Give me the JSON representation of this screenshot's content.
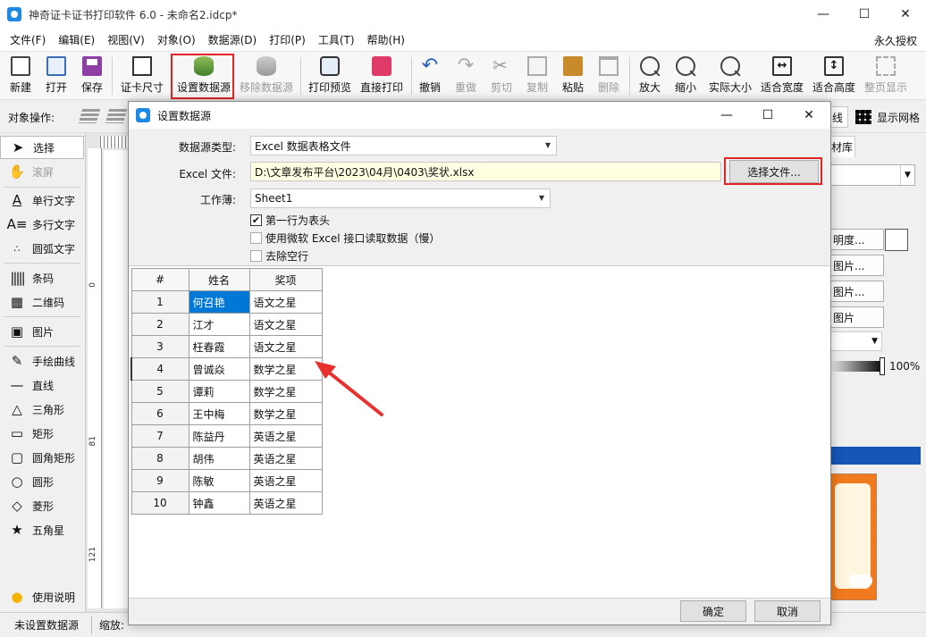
{
  "window": {
    "title": "神奇证卡证书打印软件 6.0 - 未命名2.idcp*",
    "minimize": "—",
    "maximize": "☐",
    "close": "✕"
  },
  "menu": {
    "items": [
      "文件(F)",
      "编辑(E)",
      "视图(V)",
      "对象(O)",
      "数据源(D)",
      "打印(P)",
      "工具(T)",
      "帮助(H)"
    ],
    "right": "永久授权"
  },
  "toolbar": {
    "buttons": [
      {
        "label": "新建",
        "icon": "new-file-icon"
      },
      {
        "label": "打开",
        "icon": "open-icon"
      },
      {
        "label": "保存",
        "icon": "save-icon"
      },
      {
        "label": "证卡尺寸",
        "icon": "card-size-icon"
      },
      {
        "label": "设置数据源",
        "icon": "database-icon"
      },
      {
        "label": "移除数据源",
        "icon": "remove-database-icon"
      },
      {
        "label": "打印预览",
        "icon": "print-preview-icon"
      },
      {
        "label": "直接打印",
        "icon": "printer-icon"
      },
      {
        "label": "撤销",
        "icon": "undo-icon"
      },
      {
        "label": "重做",
        "icon": "redo-icon"
      },
      {
        "label": "剪切",
        "icon": "cut-icon"
      },
      {
        "label": "复制",
        "icon": "copy-icon"
      },
      {
        "label": "粘贴",
        "icon": "paste-icon"
      },
      {
        "label": "删除",
        "icon": "delete-icon"
      },
      {
        "label": "放大",
        "icon": "zoom-in-icon"
      },
      {
        "label": "缩小",
        "icon": "zoom-out-icon"
      },
      {
        "label": "实际大小",
        "icon": "actual-size-icon"
      },
      {
        "label": "适合宽度",
        "icon": "fit-width-icon"
      },
      {
        "label": "适合高度",
        "icon": "fit-height-icon"
      },
      {
        "label": "整页显示",
        "icon": "full-page-icon"
      }
    ]
  },
  "objbar": {
    "label": "对象操作:",
    "right_partial": "线",
    "grid_label": "显示网格"
  },
  "leftpanel": {
    "items": [
      {
        "label": "选择",
        "icon": "pointer-icon"
      },
      {
        "label": "滚屏",
        "icon": "hand-icon"
      },
      {
        "label": "单行文字",
        "icon": "single-text-icon"
      },
      {
        "label": "多行文字",
        "icon": "multi-text-icon"
      },
      {
        "label": "圆弧文字",
        "icon": "arc-text-icon"
      },
      {
        "label": "条码",
        "icon": "barcode-icon"
      },
      {
        "label": "二维码",
        "icon": "qrcode-icon"
      },
      {
        "label": "图片",
        "icon": "image-icon"
      },
      {
        "label": "手绘曲线",
        "icon": "pen-icon"
      },
      {
        "label": "直线",
        "icon": "line-icon"
      },
      {
        "label": "三角形",
        "icon": "triangle-icon"
      },
      {
        "label": "矩形",
        "icon": "rectangle-icon"
      },
      {
        "label": "圆角矩形",
        "icon": "rounded-rectangle-icon"
      },
      {
        "label": "圆形",
        "icon": "circle-icon"
      },
      {
        "label": "菱形",
        "icon": "diamond-icon"
      },
      {
        "label": "五角星",
        "icon": "star-icon"
      }
    ],
    "help_label": "使用说明"
  },
  "canvas": {
    "ruler_ticks": [
      "0",
      "81",
      "121"
    ]
  },
  "rightpanel": {
    "tab_partial": "材库",
    "btn_transparency": "明度...",
    "btn_image1": "图片...",
    "btn_image2": "图片...",
    "btn_image3": "图片",
    "slider_value": "100%"
  },
  "statusbar": {
    "status": "未设置数据源",
    "zoom_label": "缩放:"
  },
  "dialog": {
    "title": "设置数据源",
    "source_type_label": "数据源类型:",
    "source_type_value": "Excel 数据表格文件",
    "file_label": "Excel 文件:",
    "file_value": "D:\\文章发布平台\\2023\\04月\\0403\\奖状.xlsx",
    "choose_file_btn": "选择文件...",
    "sheet_label": "工作薄:",
    "sheet_value": "Sheet1",
    "check_header": "第一行为表头",
    "check_ms_excel": "使用微软 Excel 接口读取数据（慢）",
    "check_remove_empty": "去除空行",
    "ok_btn": "确定",
    "cancel_btn": "取消",
    "table": {
      "headers": [
        "#",
        "姓名",
        "奖项"
      ],
      "rows": [
        [
          "1",
          "何召艳",
          "语文之星"
        ],
        [
          "2",
          "江才",
          "语文之星"
        ],
        [
          "3",
          "枉春霞",
          "语文之星"
        ],
        [
          "4",
          "曾诚焱",
          "数学之星"
        ],
        [
          "5",
          "谭莉",
          "数学之星"
        ],
        [
          "6",
          "王中梅",
          "数学之星"
        ],
        [
          "7",
          "陈益丹",
          "英语之星"
        ],
        [
          "8",
          "胡伟",
          "英语之星"
        ],
        [
          "9",
          "陈敏",
          "英语之星"
        ],
        [
          "10",
          "钟鑫",
          "英语之星"
        ]
      ]
    }
  },
  "colors": {
    "highlight_red": "#e32424",
    "selection_blue": "#0078d7",
    "arrow_red": "#e8312f"
  }
}
